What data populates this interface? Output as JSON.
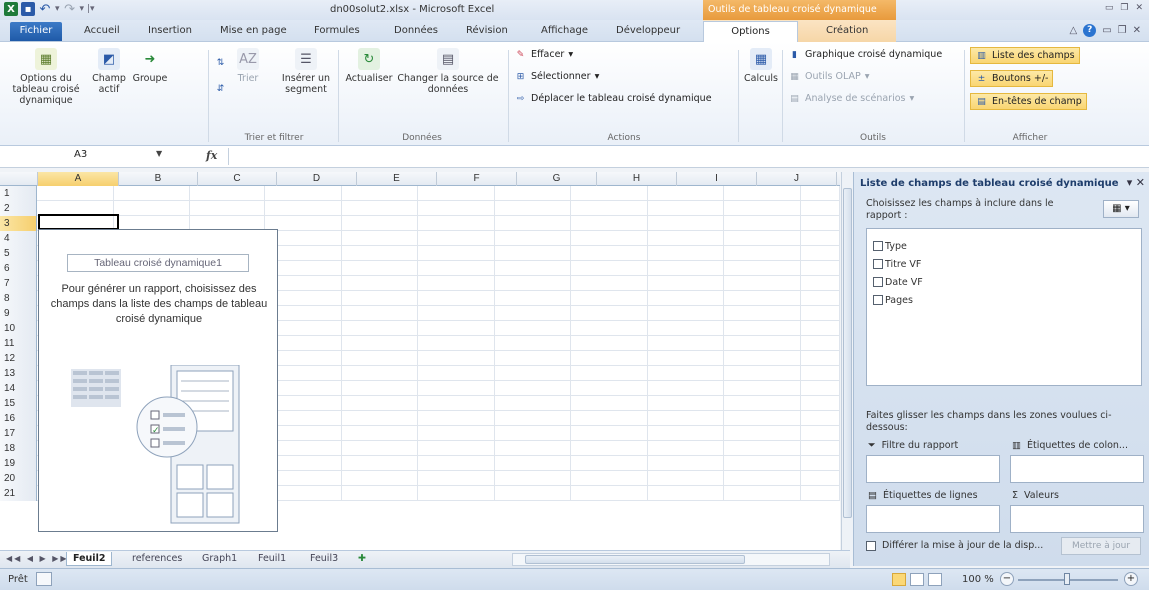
{
  "title_bar": {
    "window_title": "dn00solut2.xlsx - Microsoft Excel",
    "context_tools": "Outils de tableau croisé dynamique"
  },
  "tabs": [
    "Fichier",
    "Accueil",
    "Insertion",
    "Mise en page",
    "Formules",
    "Données",
    "Révision",
    "Affichage",
    "Développeur",
    "Options",
    "Création"
  ],
  "ribbon": {
    "pivot_options": "Options du tableau croisé dynamique",
    "active_field": "Champ actif",
    "group": "Groupe",
    "sort": "Trier",
    "insert_slicer": "Insérer un segment",
    "group_sort_filter": "Trier et filtrer",
    "refresh": "Actualiser",
    "change_source": "Changer la source de données",
    "group_data": "Données",
    "clear": "Effacer",
    "select": "Sélectionner",
    "move_pivot": "Déplacer le tableau croisé dynamique",
    "group_actions": "Actions",
    "calcs": "Calculs",
    "pivot_chart": "Graphique croisé dynamique",
    "olap_tools": "Outils OLAP",
    "whatif": "Analyse de scénarios",
    "group_tools": "Outils",
    "field_list": "Liste des champs",
    "buttons": "Boutons +/-",
    "field_headers": "En-têtes de champ",
    "group_show": "Afficher"
  },
  "formula_bar": {
    "name_box": "A3",
    "fx": "fx"
  },
  "grid": {
    "columns": [
      "A",
      "B",
      "C",
      "D",
      "E",
      "F",
      "G",
      "H",
      "I",
      "J"
    ],
    "rows": [
      "1",
      "2",
      "3",
      "4",
      "5",
      "6",
      "7",
      "8",
      "9",
      "10",
      "11",
      "12",
      "13",
      "14",
      "15",
      "16",
      "17",
      "18",
      "19",
      "20",
      "21"
    ]
  },
  "pivot_placeholder": {
    "name": "Tableau croisé dynamique1",
    "message": "Pour générer un rapport, choisissez des champs dans la liste des champs de tableau croisé dynamique"
  },
  "sheet_tabs": [
    "Feuil2",
    "references",
    "Graph1",
    "Feuil1",
    "Feuil3"
  ],
  "field_pane": {
    "title": "Liste de champs de tableau croisé dynamique",
    "choose_text": "Choisissez les champs à inclure dans le rapport :",
    "fields": [
      "Type",
      "Titre VF",
      "Date VF",
      "Pages"
    ],
    "drag_text": "Faites glisser les champs dans les zones voulues ci-dessous:",
    "report_filter": "Filtre du rapport",
    "column_labels": "Étiquettes de colon...",
    "row_labels": "Étiquettes de lignes",
    "values": "Valeurs",
    "defer_update": "Différer la mise à jour de la disp...",
    "update_button": "Mettre à jour"
  },
  "status_bar": {
    "ready": "Prêt",
    "zoom": "100 %"
  }
}
